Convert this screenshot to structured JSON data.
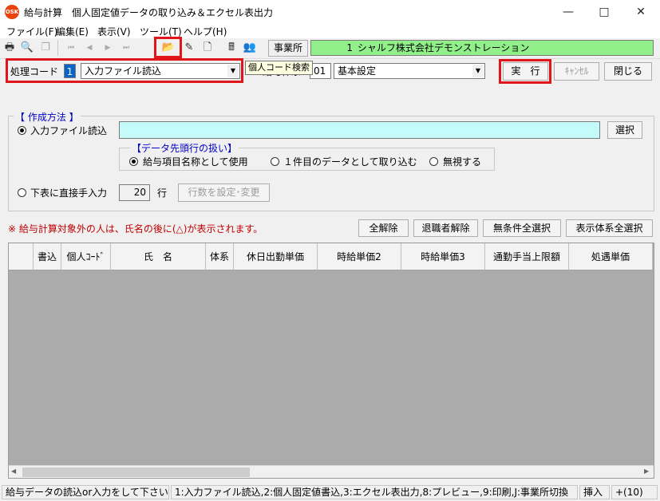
{
  "window": {
    "title": "給与計算　個人固定値データの取り込み＆エクセル表出力",
    "app_icon_text": "OSK",
    "min_icon": "minimize-icon",
    "max_icon": "maximize-icon",
    "close_icon": "close-icon"
  },
  "menu": [
    "ファイル(F)",
    "編集(E)",
    "表示(V)",
    "ツール(T)",
    "ヘルプ(H)"
  ],
  "toolbar": {
    "icons": [
      "printer-icon",
      "preview-icon",
      "copy-icon",
      "first-icon",
      "prev-icon",
      "next-icon",
      "last-icon",
      "folder-open-icon",
      "edit-icon",
      "new-page-icon",
      "calculator-icon",
      "people-icon"
    ],
    "jigyosho_label": "事業所",
    "jigyosho_no": "1",
    "jigyosho_name": "シャルフ株式会社デモンストレーション",
    "highlight_color": "#e0161a"
  },
  "proc": {
    "code_label": "処理コード",
    "code_value": "1",
    "mode_value": "入力ファイル読込",
    "tooltip": "個人コード検索",
    "sys_label": "給与体系",
    "sys_code": "01",
    "sys_value": "基本設定",
    "run_label": "実　行",
    "cancel_label": "ｷｬﾝｾﾙ",
    "close_label": "閉じる"
  },
  "method": {
    "legend": "【 作成方法 】",
    "file_radio": "入力ファイル読込",
    "file_path": "",
    "select_button": "選択",
    "header_legend": "【データ先頭行の扱い】",
    "opt_items": "給与項目名称として使用",
    "opt_first": "１件目のデータとして取り込む",
    "opt_ignore": "無視する",
    "manual_radio": "下表に直接手入力",
    "rows_value": "20",
    "rows_unit": "行",
    "rows_button": "行数を設定･変更"
  },
  "note": "※ 給与計算対象外の人は、氏名の後に(△)が表示されます。",
  "actions": [
    "全解除",
    "退職者解除",
    "無条件全選択",
    "表示体系全選択"
  ],
  "grid": {
    "columns": [
      "",
      "書込",
      "個人ｺｰﾄﾞ",
      "氏　名",
      "体系",
      "休日出勤単価",
      "時給単価2",
      "時給単価3",
      "通勤手当上限額",
      "処遇単価"
    ],
    "rows": []
  },
  "status": {
    "message": "給与データの読込or入力をして下さい",
    "keys": "1:入力ファイル読込,2:個人固定値書込,3:エクセル表出力,8:プレビュー,9:印刷,J:事業所切換",
    "mode": "挿入",
    "count": "+(10)"
  }
}
